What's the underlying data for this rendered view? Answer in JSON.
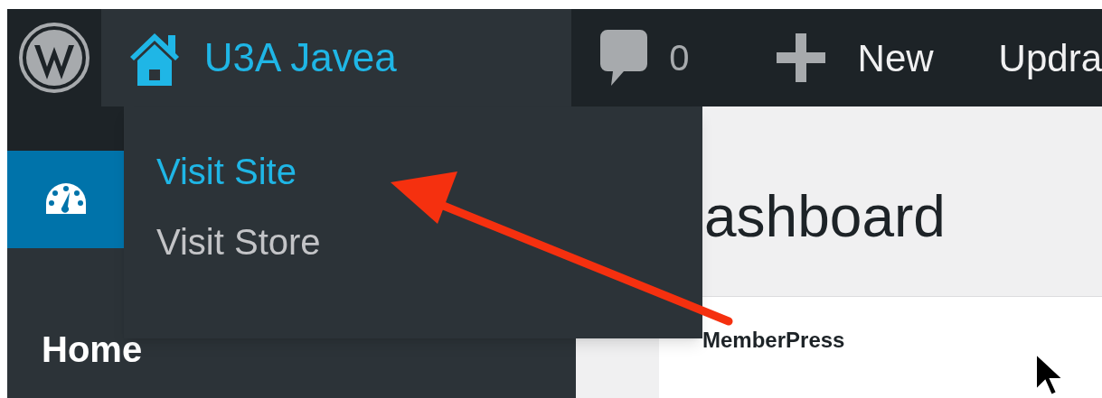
{
  "admin_bar": {
    "site_name": "U3A Javea",
    "comments_count": "0",
    "new_label": "New",
    "cut_item": "Updra"
  },
  "site_menu": {
    "expanded": true,
    "items": [
      {
        "label": "Visit Site",
        "selected": true
      },
      {
        "label": "Visit Store",
        "selected": false
      }
    ]
  },
  "sidebar": {
    "active_item_selected": true,
    "submenu_heading": "Home"
  },
  "content": {
    "heading": "ashboard",
    "card_title": "MemberPress"
  }
}
